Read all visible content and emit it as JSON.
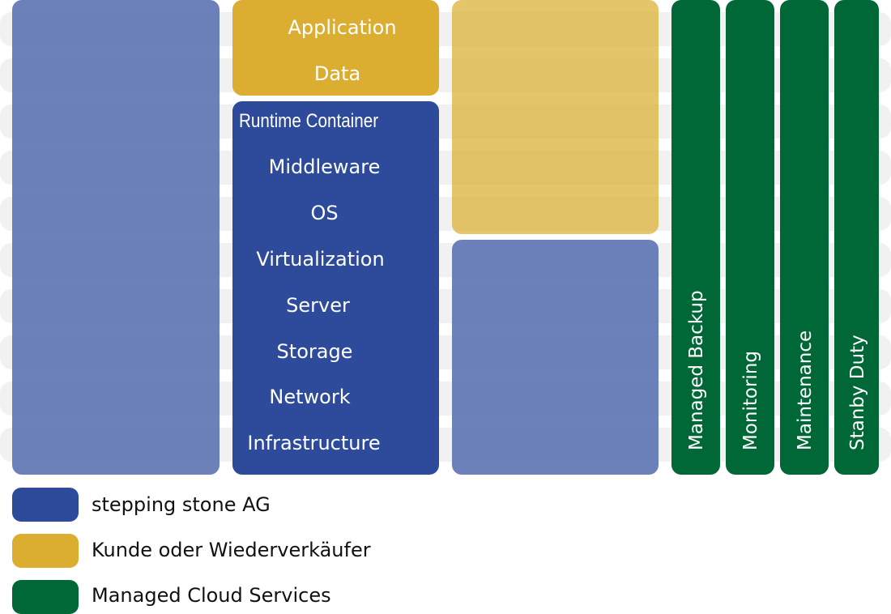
{
  "colors": {
    "stepping_stone": "#2d4b9a",
    "customer": "#dbae31",
    "managed_services": "#006837",
    "stripe": "#f1f1f1"
  },
  "stack": {
    "customer_layers": [
      "Application",
      "Data"
    ],
    "provider_layers": [
      "Runtime Container",
      "Middleware",
      "OS",
      "Virtualization",
      "Server",
      "Storage",
      "Network",
      "Infrastructure"
    ]
  },
  "services": [
    "Managed Backup",
    "Monitoring",
    "Maintenance",
    "Stanby Duty"
  ],
  "legend": [
    {
      "label": "stepping stone AG",
      "color": "#2d4b9a"
    },
    {
      "label": "Kunde oder Wiederverkäufer",
      "color": "#dbae31"
    },
    {
      "label": "Managed Cloud Services",
      "color": "#006837"
    }
  ]
}
